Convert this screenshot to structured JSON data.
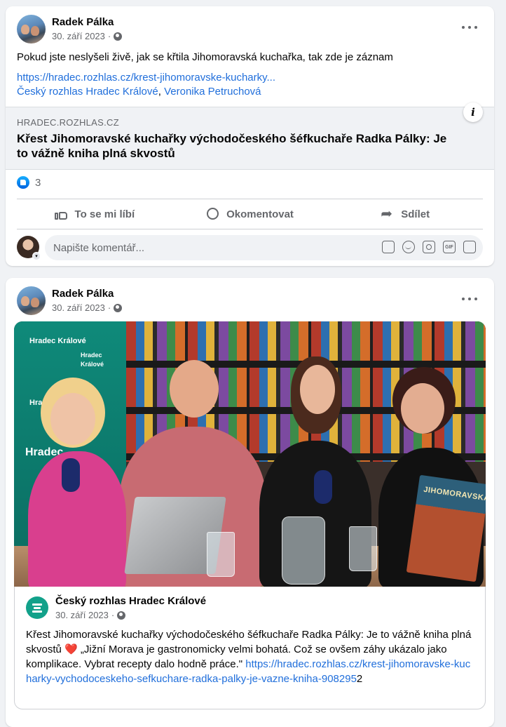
{
  "post1": {
    "author": "Radek Pálka",
    "date": "30. září 2023",
    "text": "Pokud jste neslyšeli živě, jak se křtila Jihomoravská kuchařka, tak zde je záznam",
    "url": "https://hradec.rozhlas.cz/krest-jihomoravske-kucharky...",
    "tag1": "Český rozhlas Hradec Králové",
    "tag_sep": ", ",
    "tag2": "Veronika Petruchová",
    "preview": {
      "domain": "HRADEC.ROZHLAS.CZ",
      "title": "Křest Jihomoravské kuchařky východočeského šéfkuchaře Radka Pálky: Je to vážně kniha plná skvostů"
    },
    "reaction_count": "3",
    "actions": {
      "like": "To se mi líbí",
      "comment": "Okomentovat",
      "share": "Sdílet"
    },
    "comment_placeholder": "Napište komentář..."
  },
  "post2": {
    "author": "Radek Pálka",
    "date": "30. září 2023",
    "photo": {
      "book_title": "JIHOMORAVSKÁ",
      "banner_lines": [
        "Hradec Králové",
        "Hradec Králové",
        "Hradec Králové"
      ],
      "banner_big": "Hradec"
    },
    "shared": {
      "page_name": "Český rozhlas Hradec Králové",
      "date": "30. září 2023",
      "text_a": "Křest Jihomoravské kuchařky východočeského šéfkuchaře Radka Pálky: Je to vážně kniha plná skvostů ",
      "heart": "❤️",
      "text_b": " „Jižní Morava je gastronomicky velmi bohatá. Což se ovšem záhy ukázalo jako komplikace. Vybrat recepty dalo hodně práce.\" ",
      "url": "https://hradec.rozhlas.cz/krest-jihomoravske-kucharky-vychodoceskeho-sefkuchare-radka-palky-je-vazne-kniha-908295",
      "url_tail": "2"
    }
  },
  "colors": {
    "background": "#f0f2f5",
    "link": "#216fdb",
    "muted": "#65676b",
    "like_blue": "#0866ff",
    "brand_teal": "#12a18a"
  }
}
